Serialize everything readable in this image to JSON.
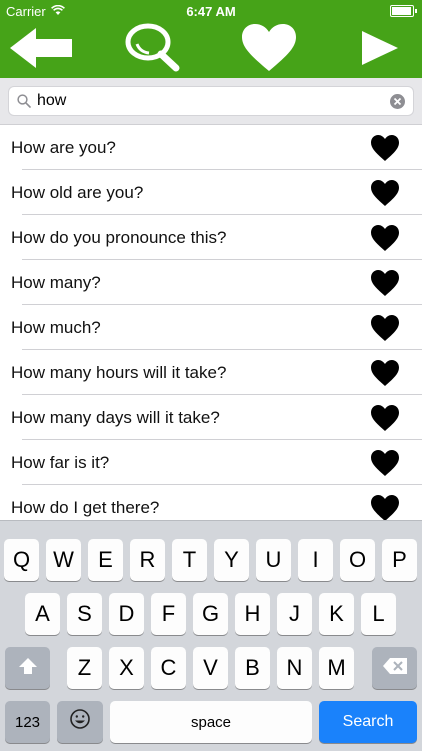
{
  "status_bar": {
    "carrier": "Carrier",
    "time": "6:47 AM",
    "battery_level": 0.95
  },
  "nav_bar": {
    "back_icon": "arrow-left-icon",
    "search_icon": "magnifier-icon",
    "favorites_icon": "heart-icon",
    "play_icon": "play-icon"
  },
  "search": {
    "value": "how",
    "search_icon": "search-icon",
    "clear_icon": "clear-icon"
  },
  "phrases": [
    {
      "text": "How are you?",
      "favorite_icon": "heart-icon"
    },
    {
      "text": "How old are you?",
      "favorite_icon": "heart-icon"
    },
    {
      "text": "How do you pronounce this?",
      "favorite_icon": "heart-icon"
    },
    {
      "text": "How many?",
      "favorite_icon": "heart-icon"
    },
    {
      "text": "How much?",
      "favorite_icon": "heart-icon"
    },
    {
      "text": "How many hours will it take?",
      "favorite_icon": "heart-icon"
    },
    {
      "text": "How many days will it take?",
      "favorite_icon": "heart-icon"
    },
    {
      "text": "How far is it?",
      "favorite_icon": "heart-icon"
    },
    {
      "text": "How do I get there?",
      "favorite_icon": "heart-icon"
    }
  ],
  "keyboard": {
    "row1": [
      "Q",
      "W",
      "E",
      "R",
      "T",
      "Y",
      "U",
      "I",
      "O",
      "P"
    ],
    "row2": [
      "A",
      "S",
      "D",
      "F",
      "G",
      "H",
      "J",
      "K",
      "L"
    ],
    "row3": [
      "Z",
      "X",
      "C",
      "V",
      "B",
      "N",
      "M"
    ],
    "shift_icon": "shift-icon",
    "delete_icon": "backspace-icon",
    "numbers_label": "123",
    "emoji_icon": "emoji-icon",
    "space_label": "space",
    "search_label": "Search"
  },
  "colors": {
    "brand_green": "#46a318",
    "search_key_blue": "#1a82fb"
  }
}
